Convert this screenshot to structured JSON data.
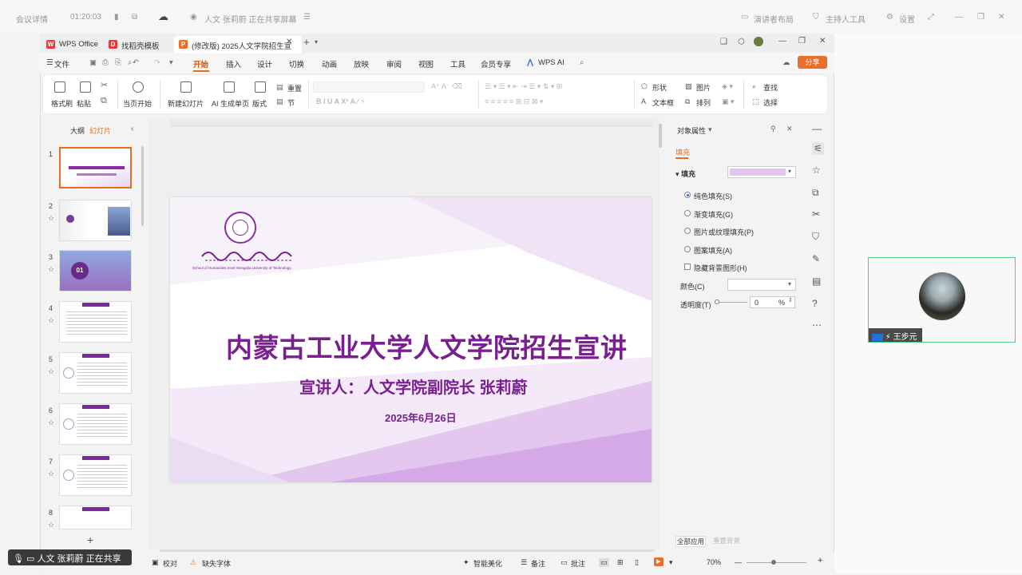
{
  "meeting_bar": {
    "details": "会议详情",
    "time": "01:20:03",
    "sharing_notice": "人文 张莉蔚 正在共享屏幕",
    "presenter_layout": "演讲者布局",
    "host_tools": "主持人工具",
    "settings": "设置"
  },
  "tabs": [
    {
      "label": "WPS Office"
    },
    {
      "label": "找稻壳模板"
    },
    {
      "label": "(修改版) 2025人文学院招生宣"
    }
  ],
  "menu": {
    "file": "文件",
    "items": [
      "开始",
      "插入",
      "设计",
      "切换",
      "动画",
      "放映",
      "审阅",
      "视图",
      "工具",
      "会员专享"
    ],
    "wps_ai": "WPS AI",
    "share": "分享"
  },
  "ribbon": {
    "format_painter": "格式刷",
    "paste": "粘贴",
    "from_current": "当页开始",
    "new_slide": "新建幻灯片",
    "ai_slides": "AI 生成单页",
    "layout": "版式",
    "reset": "重置",
    "section": "节",
    "shape": "形状",
    "picture": "图片",
    "textbox": "文本框",
    "arrange": "排列",
    "find": "查找",
    "select": "选择"
  },
  "left_panel": {
    "outline": "大纲",
    "slides": "幻灯片",
    "slide_numbers": [
      "1",
      "2",
      "3",
      "4",
      "5",
      "6",
      "7",
      "8"
    ]
  },
  "slide": {
    "college_sub": "School of Humanities Inner Mongolia University of Technology",
    "title": "内蒙古工业大学人文学院招生宣讲",
    "presenter": "宣讲人：人文学院副院长 张莉蔚",
    "date": "2025年6月26日",
    "thumb3_label": "01"
  },
  "object_props": {
    "title": "对象属性",
    "tab_fill": "填充",
    "section_fill": "填充",
    "options": [
      "纯色填充(S)",
      "渐变填充(G)",
      "图片或纹理填充(P)",
      "图案填充(A)"
    ],
    "hide_bg": "隐藏背景图形(H)",
    "color_label": "颜色(C)",
    "transparency_label": "透明度(T)",
    "transparency_value": "0",
    "percent": "%",
    "apply_all": "全部应用",
    "reset_bg": "重置背景",
    "fill_color": "#e3c4f0"
  },
  "status": {
    "sharing": "人文 张莉蔚 正在共享",
    "proof": "校对",
    "missing_font": "缺失字体",
    "beautify": "智能美化",
    "notes": "备注",
    "comments": "批注",
    "zoom": "70%"
  },
  "participant": {
    "name": "王步元"
  }
}
